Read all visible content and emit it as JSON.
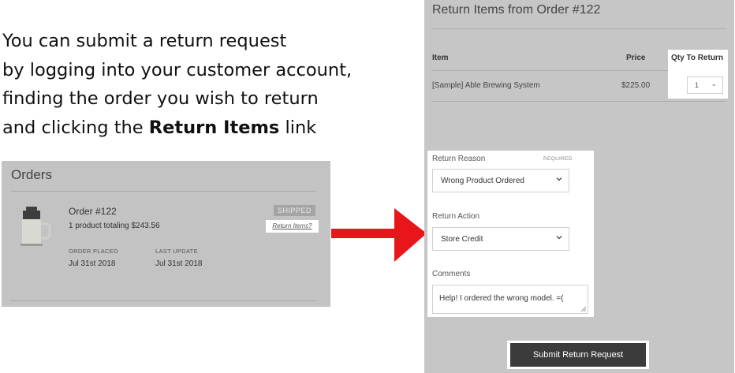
{
  "intro": {
    "line1": "You can submit a return request",
    "line2": "by logging into your customer account,",
    "line3": "finding the order you wish to return",
    "line4_before": "and clicking the ",
    "line4_bold": "Return Items",
    "line4_after": " link"
  },
  "orders": {
    "title": "Orders",
    "order_number": "Order #122",
    "summary": "1 product totaling $243.56",
    "status": "SHIPPED",
    "return_link": "Return Items?",
    "order_placed_label": "ORDER PLACED",
    "order_placed_value": "Jul 31st 2018",
    "last_update_label": "LAST UPDATE",
    "last_update_value": "Jul 31st 2018"
  },
  "return_form": {
    "title": "Return Items from Order #122",
    "columns": {
      "item": "Item",
      "price": "Price",
      "qty": "Qty To Return"
    },
    "item": {
      "name": "[Sample] Able Brewing System",
      "price": "$225.00",
      "qty": "1"
    },
    "reason_label": "Return Reason",
    "required_tag": "REQUIRED",
    "reason_value": "Wrong Product Ordered",
    "action_label": "Return Action",
    "action_value": "Store Credit",
    "comments_label": "Comments",
    "comments_value": "Help! I ordered the wrong model.  =(",
    "submit_label": "Submit Return Request"
  },
  "colors": {
    "arrow": "#e8151b",
    "panel": "#c6c6c6",
    "button": "#3b3b3b"
  },
  "icons": [
    "chevron-down-icon",
    "arrow-right-icon",
    "product-thumbnail",
    "resize-grip-icon"
  ]
}
